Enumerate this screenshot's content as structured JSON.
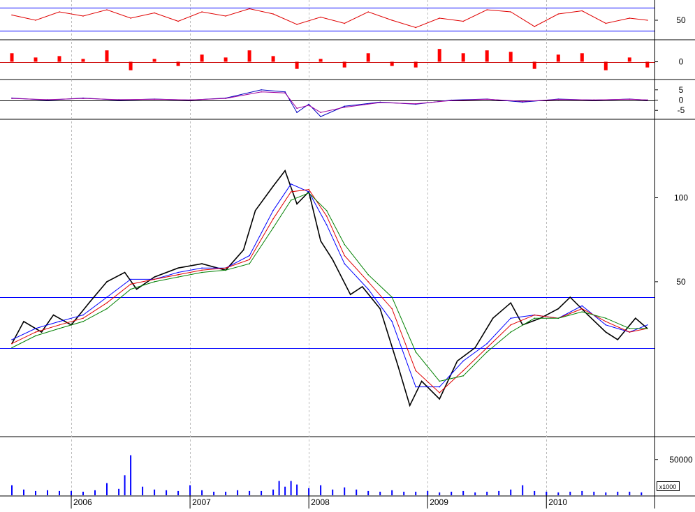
{
  "chart_data": [
    {
      "panel": "oscillator-1",
      "type": "line",
      "ylim": [
        32,
        68
      ],
      "reference_lines": [
        40,
        62
      ],
      "ticks": [
        {
          "value": 50,
          "label": "50"
        }
      ],
      "series": [
        {
          "color": "#e00000",
          "x": [
            2005.5,
            2005.7,
            2005.9,
            2006.1,
            2006.3,
            2006.5,
            2006.7,
            2006.9,
            2007.1,
            2007.3,
            2007.5,
            2007.7,
            2007.9,
            2008.1,
            2008.3,
            2008.5,
            2008.7,
            2008.9,
            2009.1,
            2009.3,
            2009.5,
            2009.7,
            2009.9,
            2010.1,
            2010.3,
            2010.5,
            2010.7,
            2010.85
          ],
          "values": [
            55,
            50,
            58,
            54,
            60,
            52,
            57,
            49,
            58,
            54,
            61,
            56,
            46,
            53,
            47,
            58,
            50,
            43,
            52,
            49,
            60,
            58,
            44,
            56,
            59,
            47,
            52,
            50
          ]
        }
      ]
    },
    {
      "panel": "oscillator-2",
      "type": "bar",
      "ylim": [
        -12,
        14
      ],
      "ticks": [
        {
          "value": 0,
          "label": "0"
        }
      ],
      "series": [
        {
          "color": "#ff0000",
          "x": [
            2005.5,
            2005.7,
            2005.9,
            2006.1,
            2006.3,
            2006.5,
            2006.7,
            2006.9,
            2007.1,
            2007.3,
            2007.5,
            2007.7,
            2007.9,
            2008.1,
            2008.3,
            2008.5,
            2008.7,
            2008.9,
            2009.1,
            2009.3,
            2009.5,
            2009.7,
            2009.9,
            2010.1,
            2010.3,
            2010.5,
            2010.7,
            2010.85
          ],
          "values": [
            6,
            3,
            4,
            2,
            8,
            -6,
            2,
            -3,
            5,
            3,
            8,
            4,
            -5,
            2,
            -4,
            6,
            -3,
            -4,
            9,
            6,
            8,
            7,
            -5,
            5,
            6,
            -6,
            3,
            -4
          ]
        }
      ]
    },
    {
      "panel": "oscillator-3",
      "type": "line",
      "ylim": [
        -9,
        9
      ],
      "reference_lines": [
        0
      ],
      "ticks": [
        {
          "value": 5,
          "label": "5"
        },
        {
          "value": 0,
          "label": "0"
        },
        {
          "value": -5,
          "label": "-5"
        }
      ],
      "series": [
        {
          "color": "#0000c0",
          "x": [
            2005.5,
            2005.8,
            2006.1,
            2006.4,
            2006.7,
            2007.0,
            2007.3,
            2007.6,
            2007.8,
            2007.9,
            2008.0,
            2008.1,
            2008.3,
            2008.6,
            2008.9,
            2009.2,
            2009.5,
            2009.8,
            2010.1,
            2010.4,
            2010.7,
            2010.85
          ],
          "values": [
            1,
            0,
            1,
            0,
            0.5,
            0,
            1,
            5,
            4,
            -6,
            -2,
            -8,
            -3,
            -1,
            -2,
            0,
            0.5,
            -1,
            0.5,
            0,
            0.5,
            0
          ]
        },
        {
          "color": "#a000a0",
          "x": [
            2005.5,
            2005.8,
            2006.1,
            2006.4,
            2006.7,
            2007.0,
            2007.3,
            2007.6,
            2007.8,
            2007.9,
            2008.0,
            2008.1,
            2008.3,
            2008.6,
            2008.9,
            2009.2,
            2009.5,
            2009.8,
            2010.1,
            2010.4,
            2010.7,
            2010.85
          ],
          "values": [
            0.8,
            0.2,
            0.8,
            0.2,
            0.4,
            0.1,
            0.8,
            4,
            3.5,
            -4,
            -2.5,
            -6,
            -3.5,
            -1.2,
            -1.8,
            -0.2,
            0.4,
            -0.6,
            0.3,
            0.1,
            0.4,
            0.1
          ]
        }
      ]
    },
    {
      "panel": "price",
      "type": "line",
      "scale": "log",
      "ylim": [
        14,
        190
      ],
      "ticks": [
        {
          "value": 100,
          "label": "100"
        },
        {
          "value": 50,
          "label": "50"
        }
      ],
      "reference_lines": [
        44,
        29
      ],
      "series": [
        {
          "color": "#000000",
          "x": [
            2005.5,
            2005.6,
            2005.75,
            2005.85,
            2006.0,
            2006.15,
            2006.3,
            2006.45,
            2006.55,
            2006.7,
            2006.9,
            2007.1,
            2007.3,
            2007.45,
            2007.55,
            2007.7,
            2007.8,
            2007.9,
            2008.0,
            2008.1,
            2008.2,
            2008.35,
            2008.45,
            2008.6,
            2008.75,
            2008.85,
            2008.95,
            2009.1,
            2009.25,
            2009.4,
            2009.55,
            2009.7,
            2009.8,
            2009.95,
            2010.1,
            2010.2,
            2010.35,
            2010.5,
            2010.6,
            2010.75,
            2010.85
          ],
          "values": [
            30,
            36,
            33,
            38,
            35,
            42,
            50,
            54,
            47,
            52,
            56,
            58,
            55,
            65,
            90,
            110,
            125,
            95,
            105,
            70,
            60,
            45,
            48,
            40,
            25,
            18,
            22,
            19,
            26,
            29,
            37,
            42,
            35,
            37,
            40,
            44,
            38,
            33,
            31,
            37,
            34
          ]
        },
        {
          "color": "#0000ff",
          "x": [
            2005.5,
            2005.7,
            2005.9,
            2006.1,
            2006.3,
            2006.5,
            2006.7,
            2006.9,
            2007.1,
            2007.3,
            2007.5,
            2007.7,
            2007.85,
            2008.0,
            2008.15,
            2008.3,
            2008.5,
            2008.7,
            2008.9,
            2009.1,
            2009.3,
            2009.5,
            2009.7,
            2009.9,
            2010.1,
            2010.3,
            2010.5,
            2010.7,
            2010.85
          ],
          "values": [
            31,
            34,
            36,
            38,
            44,
            51,
            51,
            54,
            56,
            56,
            62,
            90,
            112,
            105,
            80,
            58,
            47,
            36,
            21,
            21,
            26,
            30,
            37,
            38,
            37,
            41,
            35,
            33,
            35
          ]
        },
        {
          "color": "#e00000",
          "x": [
            2005.5,
            2005.7,
            2005.9,
            2006.1,
            2006.3,
            2006.5,
            2006.7,
            2006.9,
            2007.1,
            2007.3,
            2007.5,
            2007.7,
            2007.85,
            2008.0,
            2008.15,
            2008.3,
            2008.5,
            2008.7,
            2008.9,
            2009.1,
            2009.3,
            2009.5,
            2009.7,
            2009.9,
            2010.1,
            2010.3,
            2010.5,
            2010.7,
            2010.85
          ],
          "values": [
            30,
            33,
            35,
            37,
            42,
            49,
            51,
            53,
            55,
            56,
            60,
            84,
            105,
            107,
            86,
            62,
            50,
            40,
            24,
            20,
            24,
            29,
            35,
            38,
            37,
            40,
            36,
            33,
            34
          ]
        },
        {
          "color": "#008000",
          "x": [
            2005.5,
            2005.7,
            2005.9,
            2006.1,
            2006.3,
            2006.5,
            2006.7,
            2006.9,
            2007.1,
            2007.3,
            2007.5,
            2007.7,
            2007.85,
            2008.0,
            2008.15,
            2008.3,
            2008.5,
            2008.7,
            2008.9,
            2009.1,
            2009.3,
            2009.5,
            2009.7,
            2009.9,
            2010.1,
            2010.3,
            2010.5,
            2010.7,
            2010.85
          ],
          "values": [
            29,
            32,
            34,
            36,
            40,
            47,
            50,
            52,
            54,
            55,
            58,
            78,
            98,
            104,
            90,
            68,
            53,
            44,
            28,
            22,
            23,
            28,
            33,
            37,
            37,
            39,
            37,
            34,
            34
          ]
        }
      ]
    },
    {
      "panel": "volume",
      "type": "bar",
      "ylim": [
        0,
        80000
      ],
      "ticks": [
        {
          "value": 50000,
          "label": "50000"
        }
      ],
      "multiplier_label": "x1000",
      "series": [
        {
          "color": "#0000ff",
          "x": [
            2005.5,
            2005.6,
            2005.7,
            2005.8,
            2005.9,
            2006.0,
            2006.1,
            2006.2,
            2006.3,
            2006.4,
            2006.45,
            2006.5,
            2006.6,
            2006.7,
            2006.8,
            2006.9,
            2007.0,
            2007.1,
            2007.2,
            2007.3,
            2007.4,
            2007.5,
            2007.6,
            2007.7,
            2007.75,
            2007.8,
            2007.85,
            2007.9,
            2008.0,
            2008.1,
            2008.2,
            2008.3,
            2008.4,
            2008.5,
            2008.6,
            2008.7,
            2008.8,
            2008.9,
            2009.0,
            2009.1,
            2009.2,
            2009.3,
            2009.4,
            2009.5,
            2009.6,
            2009.7,
            2009.8,
            2009.9,
            2010.0,
            2010.1,
            2010.2,
            2010.3,
            2010.4,
            2010.5,
            2010.6,
            2010.7,
            2010.8
          ],
          "values": [
            14000,
            8000,
            6000,
            7000,
            6000,
            6000,
            5000,
            7000,
            17000,
            9000,
            28000,
            56000,
            12000,
            8000,
            7000,
            6000,
            14000,
            7000,
            5000,
            5000,
            7000,
            6000,
            6000,
            8000,
            20000,
            12000,
            20000,
            15000,
            10000,
            14000,
            8000,
            11000,
            8000,
            6000,
            5000,
            7000,
            5000,
            5000,
            6000,
            4000,
            5000,
            6000,
            4000,
            5000,
            6000,
            8000,
            14000,
            6000,
            5000,
            4000,
            5000,
            6000,
            5000,
            4000,
            5000,
            5000,
            4000
          ]
        }
      ]
    },
    {
      "panel": "x-axis",
      "type": "axis",
      "xlim": [
        2005.4,
        2010.91
      ],
      "ticks": [
        {
          "value": 2006,
          "label": "2006"
        },
        {
          "value": 2007,
          "label": "2007"
        },
        {
          "value": 2008,
          "label": "2008"
        },
        {
          "value": 2009,
          "label": "2009"
        },
        {
          "value": 2010,
          "label": "2010"
        }
      ]
    }
  ]
}
